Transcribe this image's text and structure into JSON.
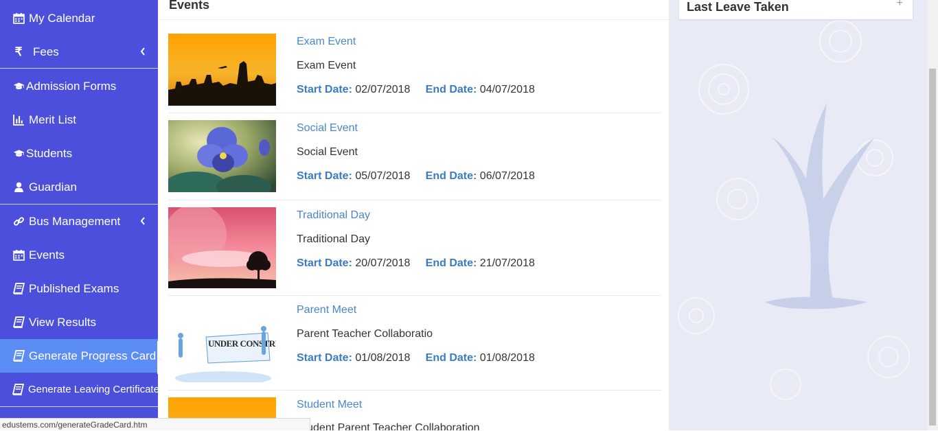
{
  "sidebar": {
    "items": [
      {
        "label": "My Calendar",
        "icon": "calendar-icon"
      },
      {
        "label": "Fees",
        "icon": "rupee-icon",
        "has_submenu": true
      },
      {
        "label": "Admission Forms",
        "icon": "graduation-cap-icon"
      },
      {
        "label": "Merit List",
        "icon": "bar-chart-icon"
      },
      {
        "label": "Students",
        "icon": "graduation-cap-icon"
      },
      {
        "label": "Guardian",
        "icon": "user-icon"
      },
      {
        "label": "Bus Management",
        "icon": "link-icon",
        "has_submenu": true
      },
      {
        "label": "Events",
        "icon": "calendar-icon"
      },
      {
        "label": "Published Exams",
        "icon": "book-icon"
      },
      {
        "label": "View Results",
        "icon": "book-icon"
      },
      {
        "label": "Generate Progress Card",
        "icon": "book-icon",
        "active": true
      },
      {
        "label": "Generate Leaving Certificate",
        "icon": "book-icon"
      }
    ]
  },
  "main": {
    "title": "Events",
    "start_label": "Start Date:",
    "end_label": "End Date:",
    "events": [
      {
        "title": "Exam Event",
        "description": "Exam Event",
        "start": "02/07/2018",
        "end": "04/07/2018",
        "image": "sunset-city"
      },
      {
        "title": "Social Event",
        "description": "Social Event",
        "start": "05/07/2018",
        "end": "06/07/2018",
        "image": "pansy-flower"
      },
      {
        "title": "Traditional Day",
        "description": "Traditional Day",
        "start": "20/07/2018",
        "end": "21/07/2018",
        "image": "pink-moon-tree"
      },
      {
        "title": "Parent Meet",
        "description": "Parent Teacher Collaboratio",
        "start": "01/08/2018",
        "end": "01/08/2018",
        "image": "under-construction",
        "image_text": "UNDER CONSTRUCTION"
      },
      {
        "title": "Student Meet",
        "description": "Student Parent Teacher Collaboration",
        "image": "sunset-city"
      }
    ]
  },
  "right_panel": {
    "title": "Last Leave Taken",
    "toggle": "+"
  },
  "status_bar": {
    "url": "edustems.com/generateGradeCard.htm"
  },
  "colors": {
    "sidebar_bg": "#4b4fdc",
    "sidebar_active": "#5b8df4",
    "link_blue": "#4a86c8",
    "label_blue": "#3a7cc1",
    "arrow_red": "#7a0f16"
  }
}
